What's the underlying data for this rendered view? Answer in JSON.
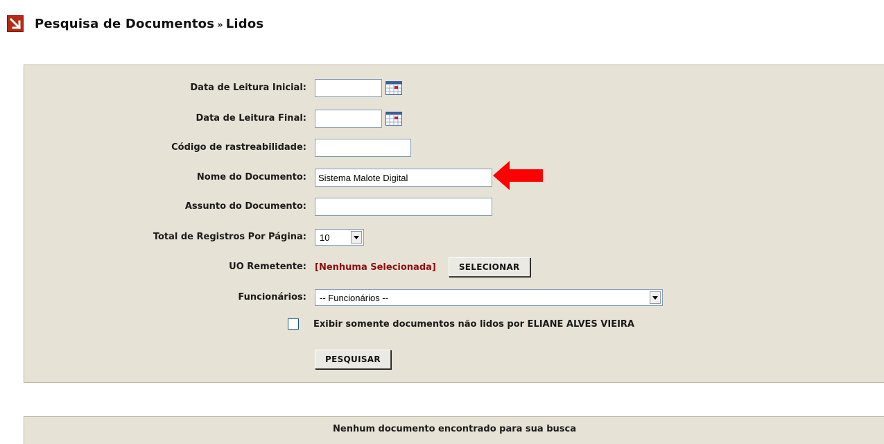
{
  "header": {
    "title": "Pesquisa de Documentos",
    "separator": "»",
    "subtitle": "Lidos"
  },
  "form": {
    "data_inicial_label": "Data de Leitura Inicial:",
    "data_inicial_value": "",
    "data_final_label": "Data de Leitura Final:",
    "data_final_value": "",
    "codigo_label": "Código de rastreabilidade:",
    "codigo_value": "",
    "nome_label": "Nome do Documento:",
    "nome_value": "Sistema Malote Digital",
    "assunto_label": "Assunto do Documento:",
    "assunto_value": "",
    "total_label": "Total de Registros Por Página:",
    "total_value": "10",
    "uo_label": "UO Remetente:",
    "uo_value": "[Nenhuma Selecionada]",
    "selecionar_button": "SELECIONAR",
    "funcionarios_label": "Funcionários:",
    "funcionarios_value": "-- Funcionários --",
    "checkbox_label": "Exibir somente documentos não lidos por ELIANE ALVES VIEIRA",
    "checkbox_checked": false,
    "pesquisar_button": "PESQUISAR"
  },
  "results": {
    "message": "Nenhum documento encontrado para sua busca"
  },
  "colors": {
    "panel_bg": "#e7e2d6",
    "uo_value_color": "#8b1010",
    "arrow_color": "#ff0000",
    "header_icon_color": "#b52a12"
  }
}
